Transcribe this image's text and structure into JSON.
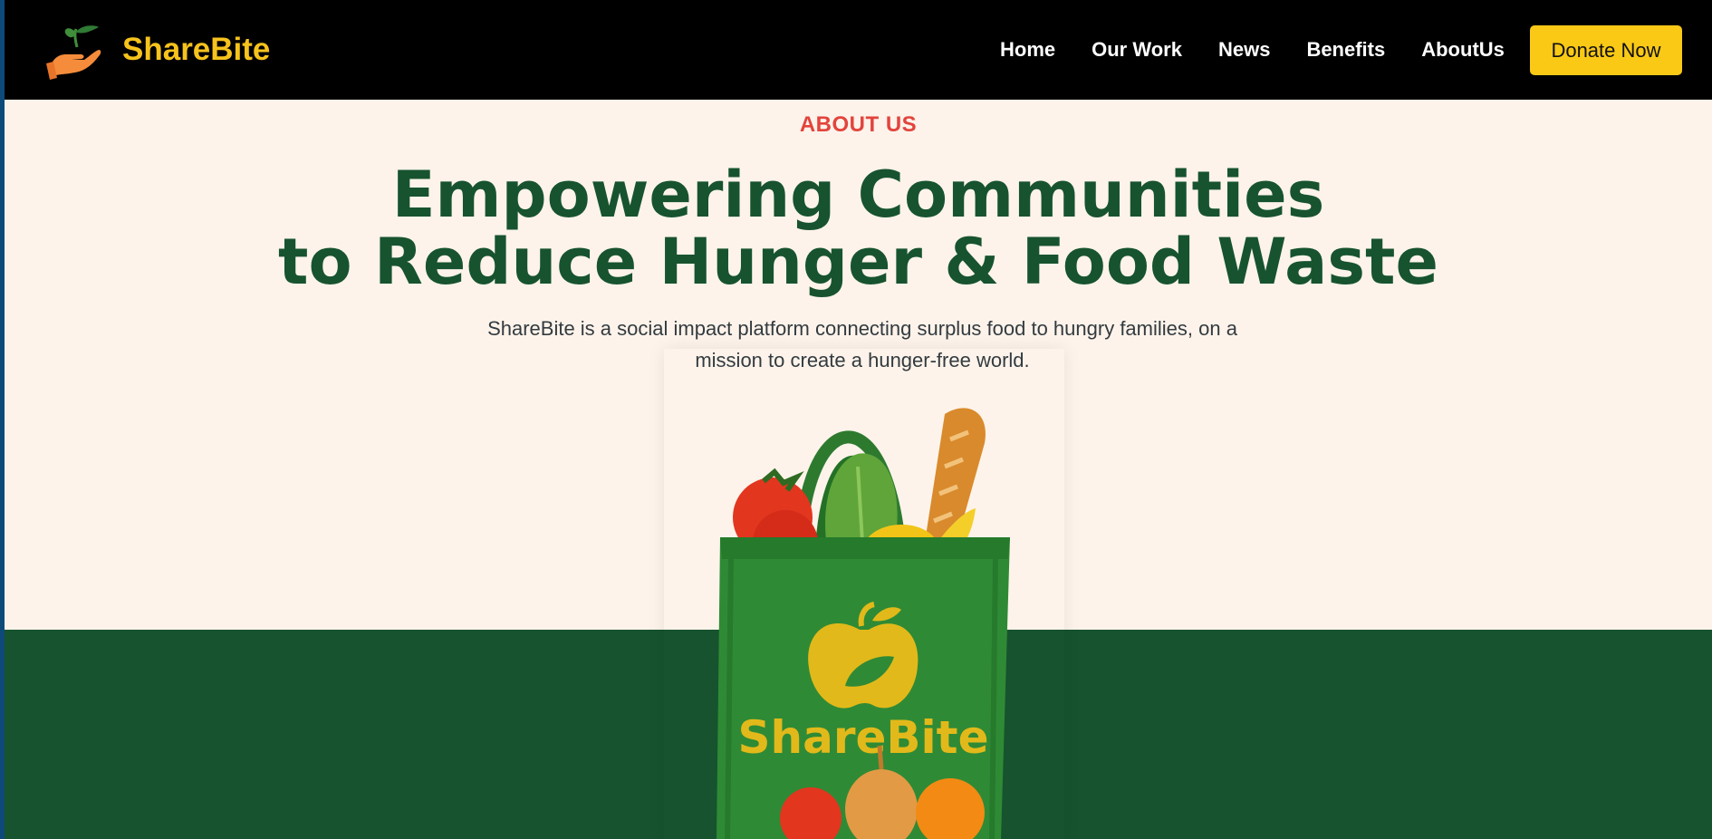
{
  "brand": {
    "name": "ShareBite",
    "logo_icon": "hand-holding-sprout-icon"
  },
  "nav": {
    "items": [
      {
        "label": "Home"
      },
      {
        "label": "Our Work"
      },
      {
        "label": "News"
      },
      {
        "label": "Benefits"
      },
      {
        "label": "AboutUs"
      }
    ],
    "donate_label": "Donate Now"
  },
  "hero": {
    "eyebrow": "ABOUT US",
    "headline_line1": "Empowering Communities",
    "headline_line2": "to Reduce Hunger & Food Waste",
    "subtitle": "ShareBite is a social impact platform connecting surplus food to hungry families, on a mission to create a hunger-free world.",
    "image": {
      "description": "ShareBite-branded-tote-bag-of-groceries",
      "bag_text": "ShareBite",
      "bag_icon": "apple-icon"
    }
  },
  "colors": {
    "nav_bg": "#000000",
    "brand_yellow": "#f6c21c",
    "donate_yellow": "#fac916",
    "eyebrow_red": "#e2443d",
    "headline_green": "#17532f",
    "hero_bg": "#fdf3ea",
    "band_green": "#17532f"
  }
}
